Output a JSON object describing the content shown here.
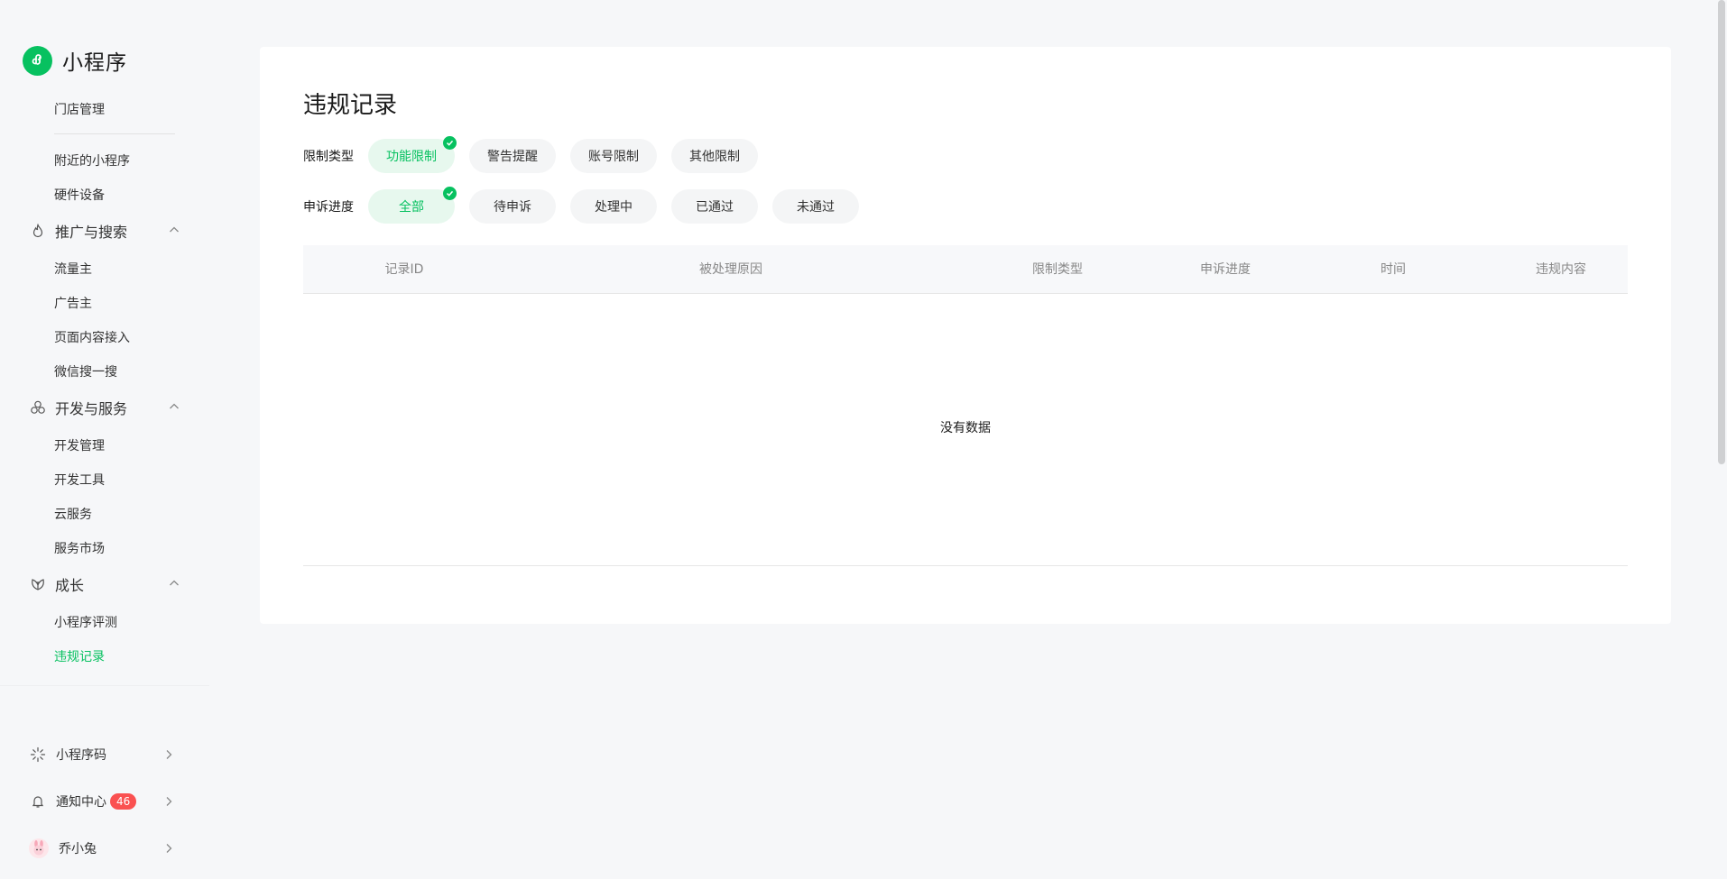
{
  "brand": {
    "title": "小程序",
    "logo_icon": "mini-program-logo-icon",
    "accent": "#07c160"
  },
  "sidebar": {
    "items_top": [
      {
        "label": "门店管理"
      },
      {
        "label": "附近的小程序"
      },
      {
        "label": "硬件设备"
      }
    ],
    "groups": [
      {
        "label": "推广与搜索",
        "icon": "fire-icon",
        "items": [
          {
            "label": "流量主"
          },
          {
            "label": "广告主"
          },
          {
            "label": "页面内容接入"
          },
          {
            "label": "微信搜一搜"
          }
        ]
      },
      {
        "label": "开发与服务",
        "icon": "cluster-icon",
        "items": [
          {
            "label": "开发管理"
          },
          {
            "label": "开发工具"
          },
          {
            "label": "云服务"
          },
          {
            "label": "服务市场"
          }
        ]
      },
      {
        "label": "成长",
        "icon": "growth-icon",
        "items": [
          {
            "label": "小程序评测"
          },
          {
            "label": "违规记录",
            "active": true
          }
        ]
      }
    ],
    "bottom": [
      {
        "label": "小程序码",
        "icon": "sparkle-icon"
      },
      {
        "label": "通知中心",
        "icon": "bell-icon",
        "badge": "46"
      },
      {
        "label": "乔小兔",
        "icon": "avatar-icon"
      }
    ]
  },
  "main": {
    "title": "违规记录",
    "filters": [
      {
        "label": "限制类型",
        "options": [
          "功能限制",
          "警告提醒",
          "账号限制",
          "其他限制"
        ],
        "selected": 0
      },
      {
        "label": "申诉进度",
        "options": [
          "全部",
          "待申诉",
          "处理中",
          "已通过",
          "未通过"
        ],
        "selected": 0
      }
    ],
    "table": {
      "columns": [
        "记录ID",
        "被处理原因",
        "限制类型",
        "申诉进度",
        "时间",
        "违规内容"
      ],
      "empty_text": "没有数据"
    }
  }
}
